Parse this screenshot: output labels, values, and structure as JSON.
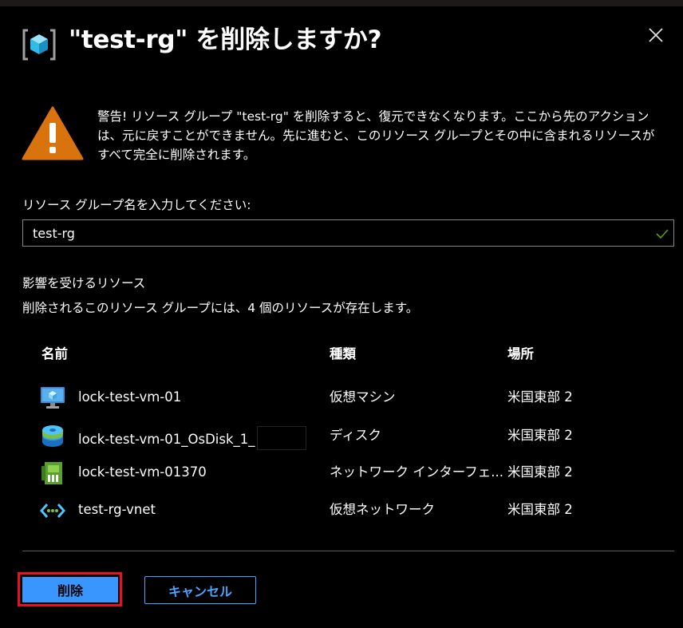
{
  "dialog": {
    "title": "\"test-rg\" を削除しますか?",
    "header_icon": "resource-group-icon",
    "close_icon": "close-icon"
  },
  "warning": {
    "icon": "warning-icon",
    "text": "警告! リソース グループ \"test-rg\" を削除すると、復元できなくなります。ここから先のアクションは、元に戻すことができません。先に進むと、このリソース グループとその中に含まれるリソースがすべて完全に削除されます。"
  },
  "confirm": {
    "label": "リソース グループ名を入力してください:",
    "value": "test-rg",
    "valid_icon": "checkmark-icon"
  },
  "affected": {
    "title": "影響を受けるリソース",
    "description": "削除されるこのリソース グループには、4 個のリソースが存在します。",
    "columns": {
      "name": "名前",
      "type": "種類",
      "location": "場所"
    },
    "rows": [
      {
        "icon": "virtual-machine-icon",
        "name": "lock-test-vm-01",
        "type": "仮想マシン",
        "location": "米国東部 2"
      },
      {
        "icon": "disk-icon",
        "name": "lock-test-vm-01_OsDisk_1_",
        "type": "ディスク",
        "location": "米国東部 2"
      },
      {
        "icon": "network-interface-icon",
        "name": "lock-test-vm-01370",
        "type": "ネットワーク インターフェ...",
        "location": "米国東部 2"
      },
      {
        "icon": "virtual-network-icon",
        "name": "test-rg-vnet",
        "type": "仮想ネットワーク",
        "location": "米国東部 2"
      }
    ]
  },
  "buttons": {
    "delete": "削除",
    "cancel": "キャンセル"
  },
  "colors": {
    "accent": "#3a96ff",
    "highlight": "#e81123",
    "warning": "#d9730d",
    "valid": "#57a300"
  }
}
